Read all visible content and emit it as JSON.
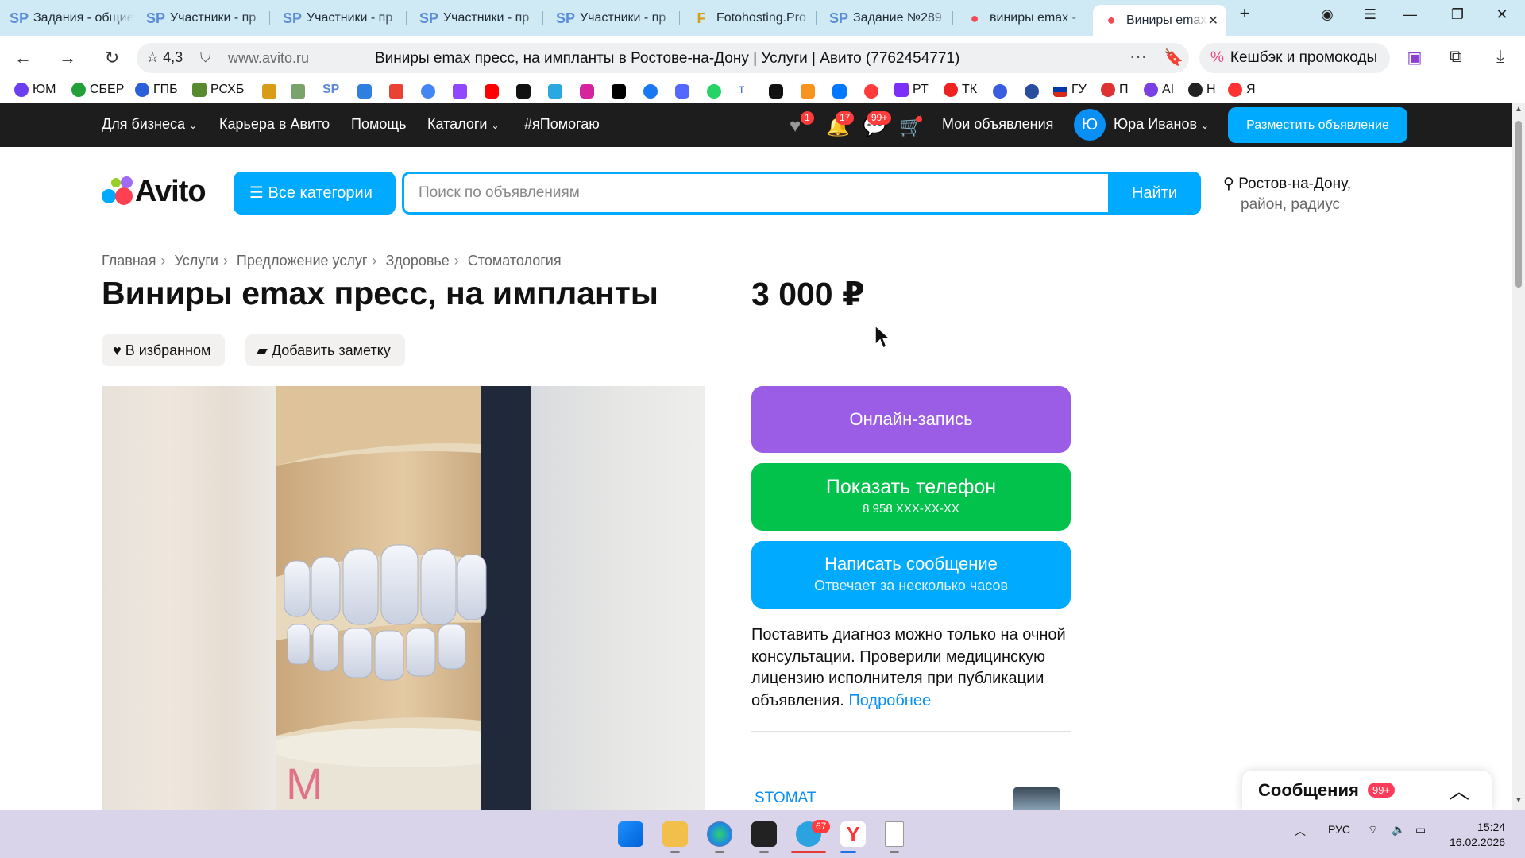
{
  "browser": {
    "tabs": [
      {
        "favicon": "SP",
        "title": "Задания - общие"
      },
      {
        "favicon": "SP",
        "title": "Участники - пр"
      },
      {
        "favicon": "SP",
        "title": "Участники - пр"
      },
      {
        "favicon": "SP",
        "title": "Участники - пр"
      },
      {
        "favicon": "SP",
        "title": "Участники - пр"
      },
      {
        "favicon": "F",
        "title": "Fotohosting.Pro"
      },
      {
        "favicon": "SP",
        "title": "Задание №289"
      },
      {
        "favicon": "●",
        "title": "виниры emax -"
      },
      {
        "favicon": "●",
        "title": "Виниры emax"
      }
    ],
    "new_tab": "+",
    "rating": "☆ 4,3",
    "domain": "www.avito.ru",
    "page_title": "Виниры emax пресс, на импланты в Ростове-на-Дону | Услуги | Авито (7762454771)",
    "cashback": "Кешбэк и промокоды",
    "bookmarks": [
      "ЮМ",
      "СБЕР",
      "ГПБ",
      "РСХБ",
      "РТ",
      "ТК",
      "ГУ",
      "П",
      "AI",
      "Н",
      "Я"
    ]
  },
  "header": {
    "business": "Для бизнеса",
    "career": "Карьера в Авито",
    "help": "Помощь",
    "catalogs": "Каталоги",
    "ihelp": "#яПомогаю",
    "fav_count": "1",
    "notif_count": "17",
    "msg_count": "99+",
    "my_ads": "Мои объявления",
    "avatar_letter": "Ю",
    "user_name": "Юра Иванов",
    "post_ad": "Разместить объявление"
  },
  "search": {
    "logo": "Avito",
    "all_categories": "Все категории",
    "placeholder": "Поиск по объявлениям",
    "find": "Найти",
    "location": "Ростов-на-Дону,",
    "location_sub": "район, радиус"
  },
  "breadcrumbs": [
    "Главная",
    "Услуги",
    "Предложение услуг",
    "Здоровье",
    "Стоматология"
  ],
  "listing": {
    "title": "Виниры emax пресс, на импланты",
    "price": "3 000 ₽",
    "favorite": "В избранном",
    "add_note": "Добавить заметку",
    "photo_mark": "M"
  },
  "actions": {
    "online_booking": "Онлайн-запись",
    "show_phone": "Показать телефон",
    "phone_masked": "8 958 XXX-XX-XX",
    "write_message": "Написать сообщение",
    "response_time": "Отвечает за несколько часов"
  },
  "notice": {
    "text": "Поставить диагноз можно только на очной консультации. Проверили медицинскую лицензию исполнителя при публикации объявления.",
    "link": "Подробнее"
  },
  "seller": {
    "name": "STOMAT"
  },
  "messages_widget": {
    "title": "Сообщения",
    "badge": "99+"
  },
  "taskbar": {
    "telegram_badge": "67",
    "lang": "РУС",
    "time": "15:24",
    "date": "16.02.2026"
  }
}
